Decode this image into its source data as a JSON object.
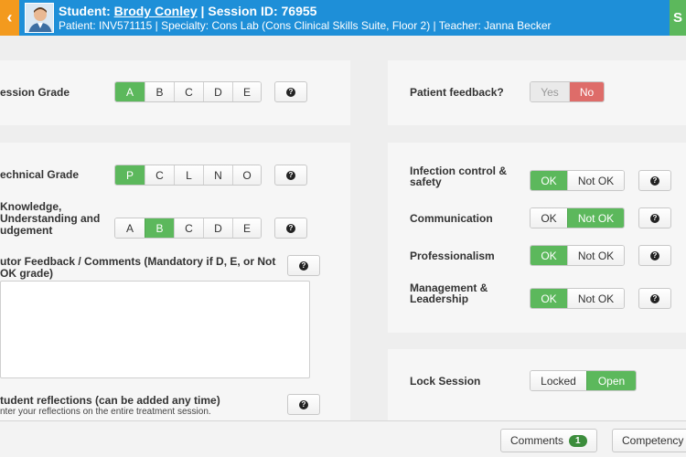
{
  "header": {
    "back_label": "‹",
    "student_prefix": "Student: ",
    "student_name": "Brody Conley",
    "session_text": " | Session ID: 76955",
    "details": "Patient: INV571115 | Specialty: Cons Lab (Cons Clinical Skills Suite, Floor 2) | Teacher: Janna Becker",
    "right_label": "S",
    "avatar_icon": "student-avatar-icon"
  },
  "session_grade": {
    "label": "ession Grade",
    "options": [
      "A",
      "B",
      "C",
      "D",
      "E"
    ],
    "selected": "A"
  },
  "patient_feedback": {
    "label": "Patient feedback?",
    "yes": "Yes",
    "no": "No",
    "selected": "No"
  },
  "technical_grade": {
    "label": "echnical Grade",
    "options": [
      "P",
      "C",
      "L",
      "N",
      "O"
    ],
    "selected": "P"
  },
  "knowledge": {
    "label_lines": [
      "Knowledge,",
      "Understanding and",
      "udgement"
    ],
    "options": [
      "A",
      "B",
      "C",
      "D",
      "E"
    ],
    "selected": "B"
  },
  "tutor_feedback": {
    "label_lines": [
      "utor Feedback / Comments (Mandatory if D, E, or Not",
      "OK grade)"
    ]
  },
  "student_reflections": {
    "label": "tudent reflections (can be added any time)",
    "hint": "nter your reflections on the entire treatment session."
  },
  "criteria": [
    {
      "label_lines": [
        "Infection control &",
        "safety"
      ],
      "ok": "OK",
      "not_ok": "Not OK",
      "selected": "OK"
    },
    {
      "label_lines": [
        "Communication"
      ],
      "ok": "OK",
      "not_ok": "Not OK",
      "selected": "Not OK"
    },
    {
      "label_lines": [
        "Professionalism"
      ],
      "ok": "OK",
      "not_ok": "Not OK",
      "selected": "OK"
    },
    {
      "label_lines": [
        "Management &",
        "Leadership"
      ],
      "ok": "OK",
      "not_ok": "Not OK",
      "selected": "OK"
    }
  ],
  "lock_session": {
    "label": "Lock Session",
    "locked": "Locked",
    "open": "Open",
    "selected": "Open"
  },
  "help_glyph": "?",
  "footer": {
    "comments_label": "Comments",
    "comments_count": "1",
    "competency_label": "Competency"
  },
  "colors": {
    "header_blue": "#1e8fd8",
    "selected_green": "#5cb85c",
    "no_red": "#d9534f",
    "back_orange": "#f39a1e"
  }
}
